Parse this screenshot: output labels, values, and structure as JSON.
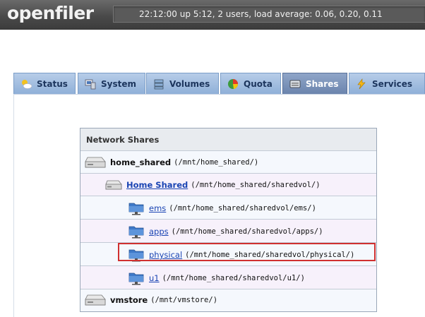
{
  "header": {
    "logo": "openfiler",
    "status": "22:12:00 up 5:12, 2 users, load average: 0.06, 0.20, 0.11"
  },
  "tabs": [
    {
      "label": "Status",
      "icon": "status-icon"
    },
    {
      "label": "System",
      "icon": "system-icon"
    },
    {
      "label": "Volumes",
      "icon": "volumes-icon"
    },
    {
      "label": "Quota",
      "icon": "quota-icon"
    },
    {
      "label": "Shares",
      "icon": "shares-icon",
      "active": true
    },
    {
      "label": "Services",
      "icon": "services-icon"
    }
  ],
  "shares": {
    "heading": "Network Shares",
    "rows": [
      {
        "name": "home_shared",
        "path": "(/mnt/home_shared/)",
        "kind": "volume-group"
      },
      {
        "name": "Home Shared",
        "path": "(/mnt/home_shared/sharedvol/)",
        "kind": "volume"
      },
      {
        "name": "ems",
        "path": "(/mnt/home_shared/sharedvol/ems/)",
        "kind": "folder"
      },
      {
        "name": "apps",
        "path": "(/mnt/home_shared/sharedvol/apps/)",
        "kind": "folder"
      },
      {
        "name": "physical",
        "path": "(/mnt/home_shared/sharedvol/physical/)",
        "kind": "folder",
        "highlighted": true
      },
      {
        "name": "u1",
        "path": "(/mnt/home_shared/sharedvol/u1/)",
        "kind": "folder"
      },
      {
        "name": "vmstore",
        "path": "(/mnt/vmstore/)",
        "kind": "volume-group"
      }
    ]
  },
  "colors": {
    "highlight_border": "#d03030",
    "link": "#1a44b3",
    "tab_active": "#6b84ad"
  }
}
